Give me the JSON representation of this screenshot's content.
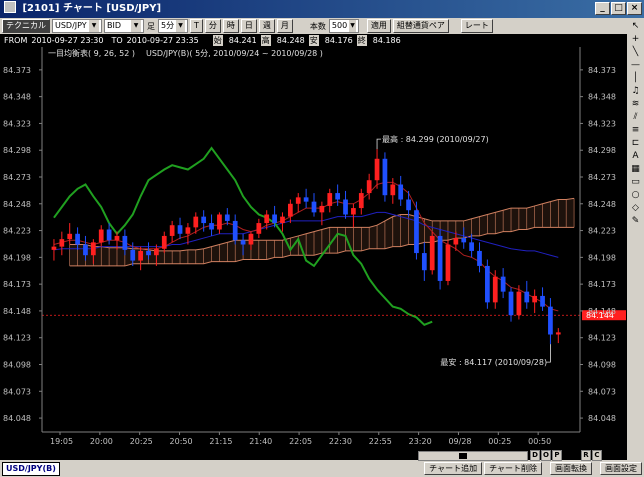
{
  "window": {
    "title": "[2101] チャート [USD/JPY]",
    "buttons": [
      "_",
      "□",
      "×"
    ]
  },
  "toolbar": {
    "technical_label": "テクニカル",
    "symbol": "USD/JPY",
    "side": "BID",
    "period_label": "足",
    "period_value": "5分",
    "unit_buttons": [
      "T",
      "分",
      "時",
      "日",
      "週",
      "月"
    ],
    "count_label": "本数",
    "count_value": "500",
    "apply_label": "適用",
    "pair_label": "組替通貨ペア",
    "rate_label": "レート"
  },
  "infobar": {
    "from_label": "FROM",
    "from_value": "2010-09-27 23:30",
    "to_label": "TO",
    "to_value": "2010-09-27 23:35",
    "open_label": "始",
    "open_value": "84.241",
    "high_label": "高",
    "high_value": "84.248",
    "low_label": "安",
    "low_value": "84.176",
    "close_label": "終",
    "close_value": "84.186"
  },
  "chart_data": {
    "type": "candlestick",
    "indicator_title": "一目均衡表( 9, 26, 52 )",
    "subtitle": "USD/JPY(B)( 5分, 2010/09/24 ~ 2010/09/28 )",
    "y_ticks": [
      "84.373",
      "84.348",
      "84.323",
      "84.298",
      "84.273",
      "84.248",
      "84.223",
      "84.198",
      "84.173",
      "84.148",
      "84.123",
      "84.098",
      "84.073",
      "84.048"
    ],
    "ylim": [
      84.035,
      84.385
    ],
    "x_ticks": [
      "19:05",
      "20:00",
      "20:25",
      "20:50",
      "21:15",
      "21:40",
      "22:05",
      "22:30",
      "22:55",
      "23:20",
      "09/28",
      "00:25",
      "00:50"
    ],
    "current_price": "84.144",
    "annotations": {
      "high": "最高 : 84.299 (2010/09/27)",
      "low": "最安 : 84.117 (2010/09/28)"
    },
    "candles": [
      [
        84.205,
        84.215,
        84.195,
        84.208
      ],
      [
        84.208,
        84.222,
        84.2,
        84.215
      ],
      [
        84.215,
        84.23,
        84.21,
        84.22
      ],
      [
        84.22,
        84.226,
        84.205,
        84.21
      ],
      [
        84.21,
        84.218,
        84.195,
        84.2
      ],
      [
        84.2,
        84.215,
        84.192,
        84.212
      ],
      [
        84.212,
        84.228,
        84.208,
        84.224
      ],
      [
        84.224,
        84.23,
        84.21,
        84.214
      ],
      [
        84.214,
        84.222,
        84.205,
        84.218
      ],
      [
        84.218,
        84.224,
        84.2,
        84.205
      ],
      [
        84.205,
        84.212,
        84.19,
        84.195
      ],
      [
        84.195,
        84.208,
        84.186,
        84.204
      ],
      [
        84.204,
        84.212,
        84.196,
        84.2
      ],
      [
        84.2,
        84.21,
        84.19,
        84.206
      ],
      [
        84.206,
        84.222,
        84.202,
        84.218
      ],
      [
        84.218,
        84.232,
        84.212,
        84.228
      ],
      [
        84.228,
        84.235,
        84.215,
        84.22
      ],
      [
        84.22,
        84.23,
        84.21,
        84.226
      ],
      [
        84.226,
        84.24,
        84.22,
        84.236
      ],
      [
        84.236,
        84.242,
        84.222,
        84.23
      ],
      [
        84.23,
        84.238,
        84.218,
        84.224
      ],
      [
        84.224,
        84.24,
        84.22,
        84.238
      ],
      [
        84.238,
        84.244,
        84.228,
        84.232
      ],
      [
        84.232,
        84.238,
        84.21,
        84.214
      ],
      [
        84.214,
        84.22,
        84.2,
        84.21
      ],
      [
        84.21,
        84.222,
        84.205,
        84.22
      ],
      [
        84.22,
        84.234,
        84.216,
        84.23
      ],
      [
        84.23,
        84.242,
        84.224,
        84.238
      ],
      [
        84.238,
        84.246,
        84.226,
        84.23
      ],
      [
        84.23,
        84.24,
        84.222,
        84.236
      ],
      [
        84.236,
        84.252,
        84.23,
        84.248
      ],
      [
        84.248,
        84.258,
        84.24,
        84.254
      ],
      [
        84.254,
        84.262,
        84.244,
        84.25
      ],
      [
        84.25,
        84.258,
        84.236,
        84.24
      ],
      [
        84.24,
        84.25,
        84.228,
        84.246
      ],
      [
        84.246,
        84.262,
        84.24,
        84.258
      ],
      [
        84.258,
        84.266,
        84.246,
        84.252
      ],
      [
        84.252,
        84.26,
        84.234,
        84.238
      ],
      [
        84.238,
        84.248,
        84.226,
        84.244
      ],
      [
        84.244,
        84.262,
        84.238,
        84.258
      ],
      [
        84.258,
        84.276,
        84.252,
        84.27
      ],
      [
        84.27,
        84.299,
        84.262,
        84.29
      ],
      [
        84.29,
        84.296,
        84.25,
        84.256
      ],
      [
        84.256,
        84.272,
        84.248,
        84.266
      ],
      [
        84.266,
        84.274,
        84.246,
        84.252
      ],
      [
        84.252,
        84.26,
        84.236,
        84.242
      ],
      [
        84.242,
        84.25,
        84.196,
        84.202
      ],
      [
        84.202,
        84.212,
        84.176,
        84.186
      ],
      [
        84.186,
        84.222,
        84.182,
        84.218
      ],
      [
        84.218,
        84.224,
        84.168,
        84.176
      ],
      [
        84.176,
        84.214,
        84.172,
        84.21
      ],
      [
        84.21,
        84.222,
        84.204,
        84.216
      ],
      [
        84.216,
        84.226,
        84.206,
        84.212
      ],
      [
        84.212,
        84.22,
        84.198,
        84.204
      ],
      [
        84.204,
        84.212,
        84.184,
        84.19
      ],
      [
        84.19,
        84.196,
        84.15,
        84.156
      ],
      [
        84.156,
        84.186,
        84.15,
        84.18
      ],
      [
        84.18,
        84.188,
        84.16,
        84.166
      ],
      [
        84.166,
        84.17,
        84.138,
        84.144
      ],
      [
        84.144,
        84.172,
        84.14,
        84.166
      ],
      [
        84.166,
        84.176,
        84.15,
        84.156
      ],
      [
        84.156,
        84.168,
        84.146,
        84.162
      ],
      [
        84.162,
        84.17,
        84.148,
        84.152
      ],
      [
        84.152,
        84.16,
        84.117,
        84.126
      ],
      [
        84.126,
        84.132,
        84.118,
        84.128
      ]
    ],
    "tenkan": [
      84.21,
      84.212,
      84.214,
      84.214,
      84.212,
      84.21,
      84.212,
      84.214,
      84.214,
      84.212,
      84.208,
      84.206,
      84.206,
      84.206,
      84.208,
      84.212,
      84.216,
      84.218,
      84.222,
      84.226,
      84.228,
      84.228,
      84.23,
      84.228,
      84.224,
      84.222,
      84.224,
      84.228,
      84.23,
      84.232,
      84.236,
      84.24,
      84.244,
      84.244,
      84.244,
      84.248,
      84.25,
      84.248,
      84.248,
      84.252,
      84.258,
      84.266,
      84.268,
      84.268,
      84.264,
      84.258,
      84.244,
      84.23,
      84.222,
      84.214,
      84.21,
      84.206,
      84.2,
      84.198,
      84.194,
      84.186,
      84.18,
      84.176,
      84.17,
      84.168,
      84.164,
      84.16,
      84.156,
      84.15,
      84.148
    ],
    "kijun": [
      84.205,
      84.206,
      84.206,
      84.206,
      84.206,
      84.206,
      84.208,
      84.208,
      84.208,
      84.208,
      84.208,
      84.208,
      84.208,
      84.208,
      84.208,
      84.21,
      84.21,
      84.212,
      84.214,
      84.216,
      84.218,
      84.22,
      84.22,
      84.22,
      84.22,
      84.222,
      84.224,
      84.226,
      84.228,
      84.23,
      84.232,
      84.232,
      84.232,
      84.232,
      84.232,
      84.234,
      84.236,
      84.236,
      84.236,
      84.236,
      84.238,
      84.24,
      84.24,
      84.238,
      84.236,
      84.234,
      84.232,
      84.228,
      84.226,
      84.224,
      84.222,
      84.22,
      84.218,
      84.216,
      84.214,
      84.212,
      84.21,
      84.208,
      84.206,
      84.205,
      84.204,
      84.204,
      84.202,
      84.2,
      84.198
    ],
    "chikou": [
      84.235,
      84.245,
      84.255,
      84.262,
      84.266,
      84.255,
      84.245,
      84.23,
      84.22,
      84.228,
      84.238,
      84.255,
      84.27,
      84.275,
      84.28,
      84.284,
      84.282,
      84.28,
      84.285,
      84.29,
      84.3,
      84.29,
      84.28,
      84.27,
      84.255,
      84.245,
      84.238,
      84.235,
      84.23,
      84.22,
      84.205,
      84.215,
      84.195,
      84.19,
      84.2,
      84.21,
      84.22,
      84.218,
      84.2,
      84.192,
      84.178,
      84.168,
      84.16,
      84.152,
      84.15,
      84.145,
      84.142,
      84.135,
      84.138
    ],
    "span_a": [
      84.21,
      84.21,
      84.21,
      84.208,
      84.208,
      84.207,
      84.207,
      84.207,
      84.206,
      84.206,
      84.205,
      84.204,
      84.204,
      84.204,
      84.204,
      84.205,
      84.205,
      84.206,
      84.208,
      84.21,
      84.212,
      84.214,
      84.214,
      84.214,
      84.214,
      84.214,
      84.214,
      84.214,
      84.216,
      84.218,
      84.22,
      84.222,
      84.224,
      84.226,
      84.226,
      84.226,
      84.226,
      84.226,
      84.226,
      84.228,
      84.232,
      84.236,
      84.238,
      84.238,
      84.236,
      84.234,
      84.232,
      84.232,
      84.232,
      84.232,
      84.232,
      84.234,
      84.236,
      84.238,
      84.24,
      84.242,
      84.244,
      84.244,
      84.244,
      84.246,
      84.248,
      84.25,
      84.252,
      84.252,
      84.253
    ],
    "span_b": [
      84.19,
      84.19,
      84.19,
      84.19,
      84.19,
      84.19,
      84.19,
      84.19,
      84.192,
      84.192,
      84.192,
      84.192,
      84.192,
      84.192,
      84.192,
      84.192,
      84.192,
      84.192,
      84.194,
      84.194,
      84.194,
      84.194,
      84.196,
      84.196,
      84.196,
      84.196,
      84.198,
      84.198,
      84.2,
      84.2,
      84.2,
      84.2,
      84.202,
      84.202,
      84.202,
      84.204,
      84.204,
      84.204,
      84.206,
      84.206,
      84.206,
      84.208,
      84.208,
      84.21,
      84.21,
      84.212,
      84.212,
      84.214,
      84.214,
      84.216,
      84.216,
      84.218,
      84.218,
      84.22,
      84.22,
      84.222,
      84.222,
      84.224,
      84.224,
      84.226,
      84.226,
      84.226,
      84.226,
      84.226,
      84.226
    ],
    "colors": {
      "bull": "#ff2020",
      "bear": "#2050ff",
      "tenkan": "#b02020",
      "kijun": "#2020c0",
      "chikou": "#20a020",
      "cloud": "#d08060",
      "current": "#ff2020",
      "axis_text": "#c0c0c0"
    }
  },
  "right_tools": [
    "cursor-icon",
    "crosshair-icon",
    "line-icon",
    "hline-icon",
    "vline-icon",
    "bell-icon",
    "fib-icon",
    "trend-icon",
    "channel-icon",
    "fork-icon",
    "text-icon",
    "grid-icon",
    "rect-icon",
    "ellipse-icon",
    "eraser-icon",
    "edit-icon"
  ],
  "nav": [
    "D",
    "O",
    "P",
    "R",
    "C"
  ],
  "bottom": {
    "symbol_tab": "USD/JPY(B)",
    "add_chart": "チャート追加",
    "del_chart": "チャート削除",
    "switch_view": "画面転換",
    "settings": "画面設定"
  }
}
